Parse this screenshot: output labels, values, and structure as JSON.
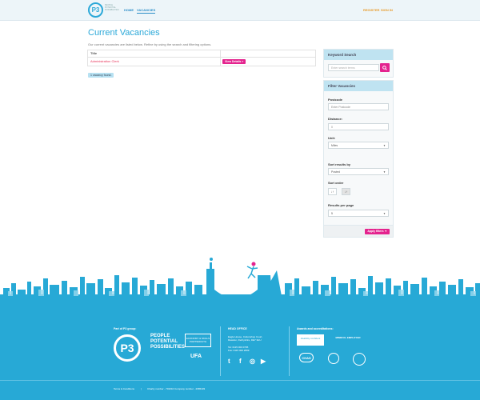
{
  "header": {
    "logo_text": "P3",
    "logo_sub": "PEOPLE POTENTIAL POSSIBILITIES",
    "nav": [
      {
        "label": "HOME"
      },
      {
        "label": "VACANCIES"
      }
    ],
    "register_label": "REGISTER",
    "signin_label": "SIGN IN"
  },
  "main": {
    "title": "Current Vacancies",
    "intro": "Our current vacancies are listed below. Refine by using the search and filtering options.",
    "table": {
      "header_title": "Title",
      "rows": [
        {
          "title": "Administration Clerk",
          "button": "View Details »"
        }
      ]
    },
    "found": "1 vacancy found."
  },
  "keyword_search": {
    "heading": "Keyword Search",
    "placeholder": "Enter search terms"
  },
  "filter": {
    "heading": "Filter Vacancies",
    "postcode_label": "Postcode",
    "postcode_placeholder": "Enter Postcode",
    "distance_label": "Distance:",
    "distance_value": "0",
    "unit_label": "Unit:",
    "unit_value": "Miles",
    "sort_by_label": "Sort results by",
    "sort_by_value": "Posted",
    "sort_order_label": "Sort order",
    "sort_asc": "↓↑",
    "sort_desc": "↓↑",
    "per_page_label": "Results per page",
    "per_page_value": "5",
    "apply_label": "Apply filters ▼"
  },
  "footer": {
    "group_heading": "Part of P3 group:",
    "p3_text": "P3",
    "tagline": [
      "PEOPLE",
      "POTENTIAL",
      "POSSIBILITIES"
    ],
    "badge1": "ECONOMY & SKILLS PORTSMOUTH",
    "badge2": "UFA",
    "head_office_heading": "HEAD OFFICE",
    "address": [
      "Eagle House, Cottonshop Court,",
      "Rawdon, Derbyshire, DE7 3HU"
    ],
    "tel": "Tel: 0115 000 0795",
    "fax": "Fax: 0115 000 2809",
    "social": [
      "t",
      "f",
      "◎",
      "▶"
    ],
    "awards_heading": "Awards and accreditations:",
    "award1": "disability confident",
    "award2": "MINDFUL EMPLOYER",
    "award3": "CHAS",
    "award4": "",
    "terms_label": "Terms & Conditions",
    "charity": "Charity number - 701010 Company number - 2965433"
  },
  "colors": {
    "accent": "#2ba8d8",
    "button": "#e4238e",
    "footer": "#27a9d6"
  }
}
